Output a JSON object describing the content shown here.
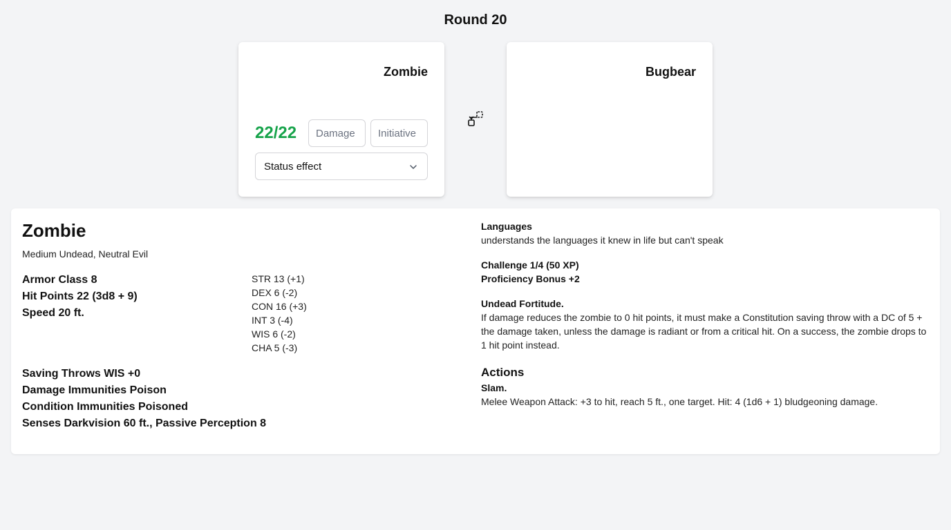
{
  "round": {
    "title": "Round 20"
  },
  "left_card": {
    "name": "Zombie",
    "hp": "22/22",
    "hp_color": "#16a34a",
    "damage_placeholder": "Damage",
    "initiative_placeholder": "Initiative",
    "status_select": {
      "selected": "Status effect",
      "icon": "chevron-down-icon"
    }
  },
  "swap_button": {
    "icon": "swap-arrow-icon"
  },
  "right_card": {
    "name": "Bugbear"
  },
  "monster": {
    "name": "Zombie",
    "type_line": "Medium Undead, Neutral Evil",
    "armor_class": "Armor Class 8",
    "hit_points": "Hit Points 22 (3d8 + 9)",
    "speed": "Speed 20 ft.",
    "abilities": [
      "STR 13 (+1)",
      "DEX 6 (-2)",
      "CON 16 (+3)",
      "INT 3 (-4)",
      "WIS 6 (-2)",
      "CHA 5 (-3)"
    ],
    "saving_throws": "Saving Throws WIS +0",
    "damage_immunities": "Damage Immunities Poison",
    "condition_immunities": "Condition Immunities Poisoned",
    "senses": "Senses Darkvision 60 ft., Passive Perception 8",
    "languages_label": "Languages",
    "languages": "understands the languages it knew in life but can't speak",
    "challenge": "Challenge 1/4 (50 XP)",
    "proficiency": "Proficiency Bonus +2",
    "trait_name": "Undead Fortitude.",
    "trait_text": "If damage reduces the zombie to 0 hit points, it must make a Constitution saving throw with a DC of 5 + the damage taken, unless the damage is radiant or from a critical hit. On a success, the zombie drops to 1 hit point instead.",
    "actions_heading": "Actions",
    "action_name": "Slam.",
    "action_text": "Melee Weapon Attack: +3 to hit, reach 5 ft., one target. Hit: 4 (1d6 + 1) bludgeoning damage."
  }
}
